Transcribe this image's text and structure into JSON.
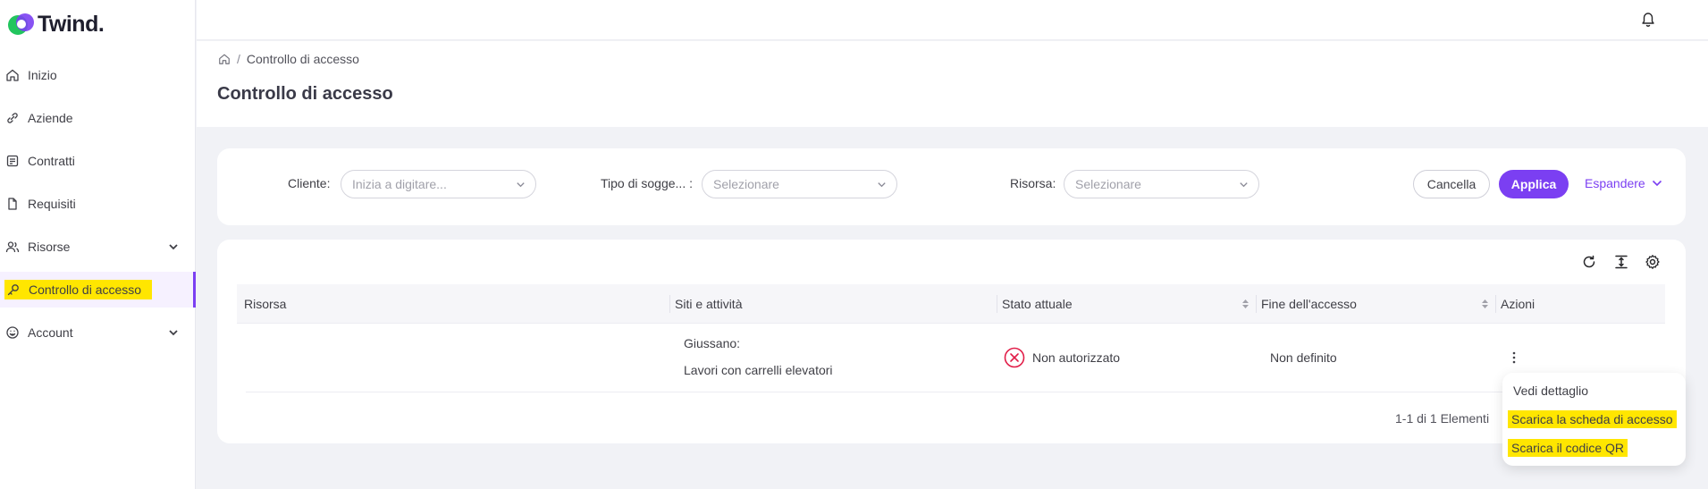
{
  "app": {
    "brand": "Twind."
  },
  "sidebar": {
    "items": [
      {
        "label": "Inizio",
        "icon": "home-icon"
      },
      {
        "label": "Aziende",
        "icon": "link-icon"
      },
      {
        "label": "Contratti",
        "icon": "contract-icon"
      },
      {
        "label": "Requisiti",
        "icon": "document-icon"
      },
      {
        "label": "Risorse",
        "icon": "people-icon",
        "expandable": true
      },
      {
        "label": "Controllo di accesso",
        "icon": "key-icon",
        "active": true
      },
      {
        "label": "Account",
        "icon": "account-icon",
        "expandable": true
      }
    ]
  },
  "header": {
    "breadcrumb": {
      "current": "Controllo di accesso"
    },
    "title": "Controllo di accesso"
  },
  "filters": {
    "cliente": {
      "label": "Cliente",
      "placeholder": "Inizia a digitare..."
    },
    "tipo": {
      "label": "Tipo di sogge...",
      "placeholder": "Selezionare"
    },
    "risorsa": {
      "label": "Risorsa",
      "placeholder": "Selezionare"
    },
    "cancel_label": "Cancella",
    "apply_label": "Applica",
    "expand_label": "Espandere"
  },
  "table": {
    "columns": [
      "Risorsa",
      "Siti e attività",
      "Stato attuale",
      "Fine dell'accesso",
      "Azioni"
    ],
    "rows": [
      {
        "risorsa": "",
        "sito": "Giussano:",
        "attivita": "Lavori con carrelli elevatori",
        "stato": "Non autorizzato",
        "fine": "Non definito"
      }
    ],
    "pagination": "1-1 di 1 Elementi"
  },
  "action_menu": {
    "items": [
      "Vedi dettaglio",
      "Scarica la scheda di accesso",
      "Scarica il codice QR"
    ]
  },
  "colors": {
    "accent": "#7b3ff2",
    "highlight": "#ffe600",
    "error": "#e11d48"
  }
}
